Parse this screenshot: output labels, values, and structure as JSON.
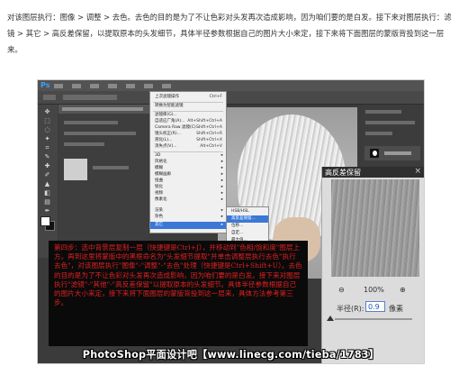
{
  "article": {
    "intro": "对该图层执行：图像 > 调整 > 去色。去色的目的是为了不让色彩对头发再次造成影响，因为咱们要的是白发。接下来对图层执行：滤镜 > 其它 > 高反差保留，以提取原本的头发细节，具体半径参数根据自己的图片大小来定，接下来将下面图层的蒙版背投到这一层来。"
  },
  "screenshot": {
    "app_logo": "Ps",
    "filter_menu": {
      "items": [
        {
          "label": "上次滤镜操作",
          "shortcut": "Ctrl+F"
        },
        {
          "label": "转换为智能滤镜",
          "shortcut": ""
        },
        {
          "label": "滤镜库(G)...",
          "shortcut": ""
        },
        {
          "label": "自适应广角(A)...",
          "shortcut": "Alt+Shift+Ctrl+A"
        },
        {
          "label": "Camera Raw 滤镜(C)...",
          "shortcut": "Shift+Ctrl+A"
        },
        {
          "label": "镜头校正(R)...",
          "shortcut": "Shift+Ctrl+R"
        },
        {
          "label": "液化(L)...",
          "shortcut": "Shift+Ctrl+X"
        },
        {
          "label": "消失点(V)...",
          "shortcut": "Alt+Ctrl+V"
        },
        {
          "label": "3D",
          "shortcut": ""
        },
        {
          "label": "风格化",
          "shortcut": ""
        },
        {
          "label": "模糊",
          "shortcut": ""
        },
        {
          "label": "模糊画廊",
          "shortcut": ""
        },
        {
          "label": "扭曲",
          "shortcut": ""
        },
        {
          "label": "锐化",
          "shortcut": ""
        },
        {
          "label": "视频",
          "shortcut": ""
        },
        {
          "label": "像素化",
          "shortcut": ""
        },
        {
          "label": "渲染",
          "shortcut": ""
        },
        {
          "label": "杂色",
          "shortcut": ""
        },
        {
          "label": "其它",
          "shortcut": ""
        }
      ]
    },
    "other_submenu": {
      "items": [
        "HSB/HSL",
        "高反差保留...",
        "位移...",
        "自定...",
        "最大值...",
        "最小值..."
      ]
    },
    "dialog": {
      "title": "高反差保留",
      "close": "×",
      "zoom_out": "⊖",
      "zoom_level": "100%",
      "zoom_in": "⊕",
      "radius_label": "半径(R):",
      "radius_value": "0.9",
      "radius_unit": "像素"
    },
    "caption": "第四步：选中背景层复制一层（快捷键是Ctrl+J），并移动到\"色相/饱和度\"图层上方。再到这里将蒙版中的黑框命名为\"头发细节提取\"并单击调整层执行去色\"执行去色\"，对该图层执行\"图像\"-\"调整\"-\"去色\"处理（快捷键是Ctrl+Shift+U）。去色的目的是为了不让色彩对头发再次造成影响，因为咱们要的是白发。接下来对图层执行\"滤镜\"-\"其他\"-\"高反差保留\"以提取原本的头发细节。具体半径参数根据自己的图片大小来定，接下来将下面图层的蒙版背投到这一层来，具体方法参考第三步。",
    "watermark": "PhotoShop平面设计吧【www.linecg.com/tieba/1783】"
  }
}
